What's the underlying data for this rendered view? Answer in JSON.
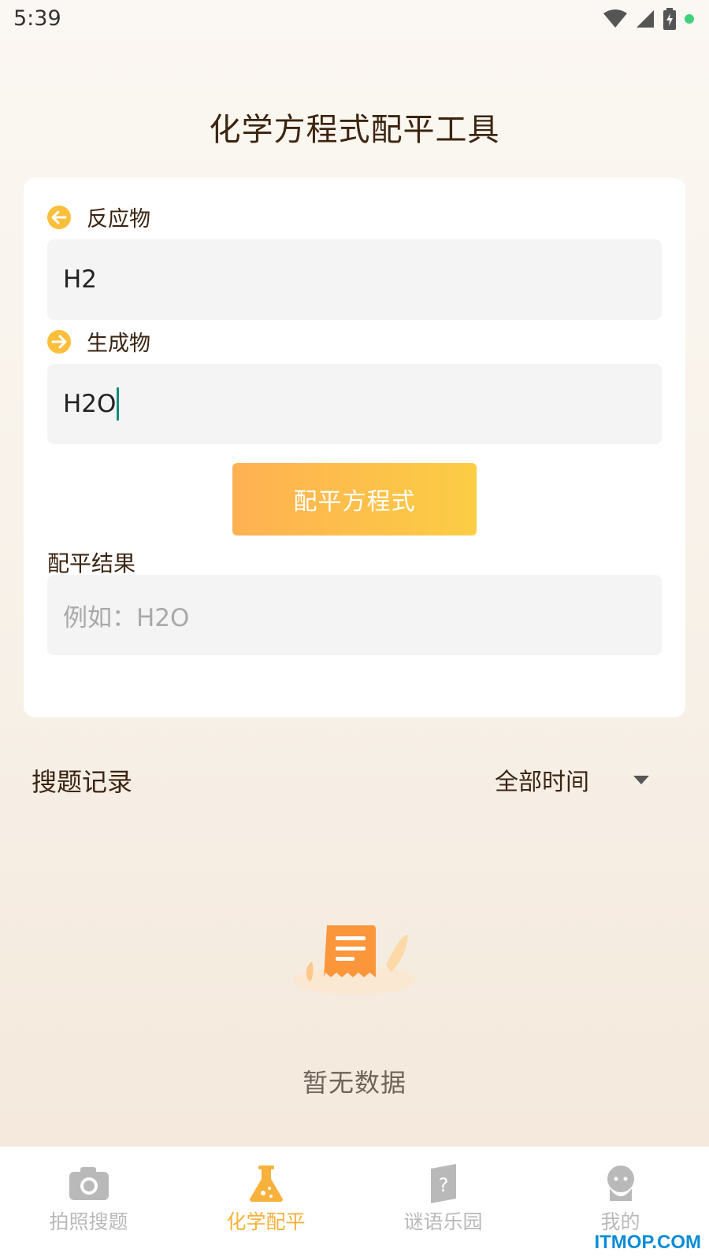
{
  "status_bar": {
    "time": "5:39"
  },
  "header": {
    "title": "化学方程式配平工具"
  },
  "form": {
    "reactant_label": "反应物",
    "reactant_value": "H2",
    "product_label": "生成物",
    "product_value": "H2O",
    "balance_button": "配平方程式",
    "result_label": "配平结果",
    "result_placeholder": "例如：H2O"
  },
  "records": {
    "title": "搜题记录",
    "time_filter": "全部时间",
    "empty_text": "暂无数据"
  },
  "bottom_nav": {
    "items": [
      {
        "label": "拍照搜题",
        "icon": "camera-icon"
      },
      {
        "label": "化学配平",
        "icon": "flask-icon"
      },
      {
        "label": "谜语乐园",
        "icon": "riddle-icon"
      },
      {
        "label": "我的",
        "icon": "profile-icon"
      }
    ],
    "active_index": 1
  },
  "watermark": "ITMOP.COM",
  "colors": {
    "accent": "#f8b23b",
    "button_gradient_start": "#ffb152",
    "button_gradient_end": "#fbcd44",
    "title_text": "#3c240e"
  }
}
